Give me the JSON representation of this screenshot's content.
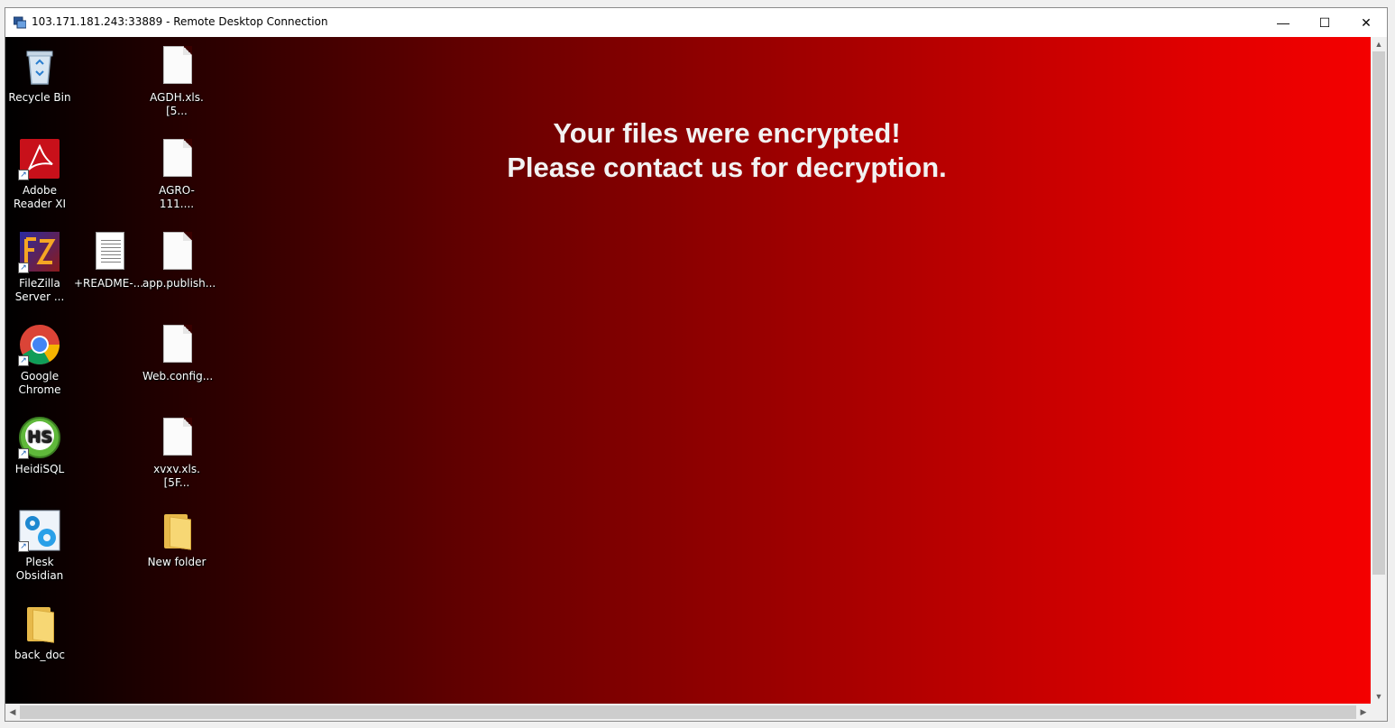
{
  "window": {
    "title": "103.171.181.243:33889 - Remote Desktop Connection",
    "minimize_glyph": "—",
    "maximize_glyph": "☐",
    "close_glyph": "✕"
  },
  "ransom_note": {
    "line1": "Your files were encrypted!",
    "line2": "Please contact us for decryption."
  },
  "desktop_icons": [
    {
      "label": "Recycle Bin",
      "icon": "recycle-bin-icon"
    },
    {
      "label": "Adobe Reader XI",
      "icon": "adobe-reader-icon"
    },
    {
      "label": "FileZilla Server ...",
      "icon": "filezilla-icon"
    },
    {
      "label": "Google Chrome",
      "icon": "chrome-icon"
    },
    {
      "label": "HeidiSQL",
      "icon": "heidisql-icon"
    },
    {
      "label": "Plesk Obsidian",
      "icon": "plesk-icon"
    },
    {
      "label": "back_doc",
      "icon": "folder-icon"
    },
    {
      "label": "+README-...",
      "icon": "text-file-icon"
    },
    {
      "label": "AGDH.xls.[5...",
      "icon": "file-icon"
    },
    {
      "label": "AGRO-111....",
      "icon": "file-icon"
    },
    {
      "label": "app.publish...",
      "icon": "file-icon"
    },
    {
      "label": "Web.config...",
      "icon": "file-icon"
    },
    {
      "label": "xvxv.xls.[5F...",
      "icon": "file-icon"
    },
    {
      "label": "New folder",
      "icon": "folder-icon"
    }
  ],
  "colors": {
    "gradient_start": "#000000",
    "gradient_end": "#f40000",
    "note_text": "#f2f2f2"
  }
}
